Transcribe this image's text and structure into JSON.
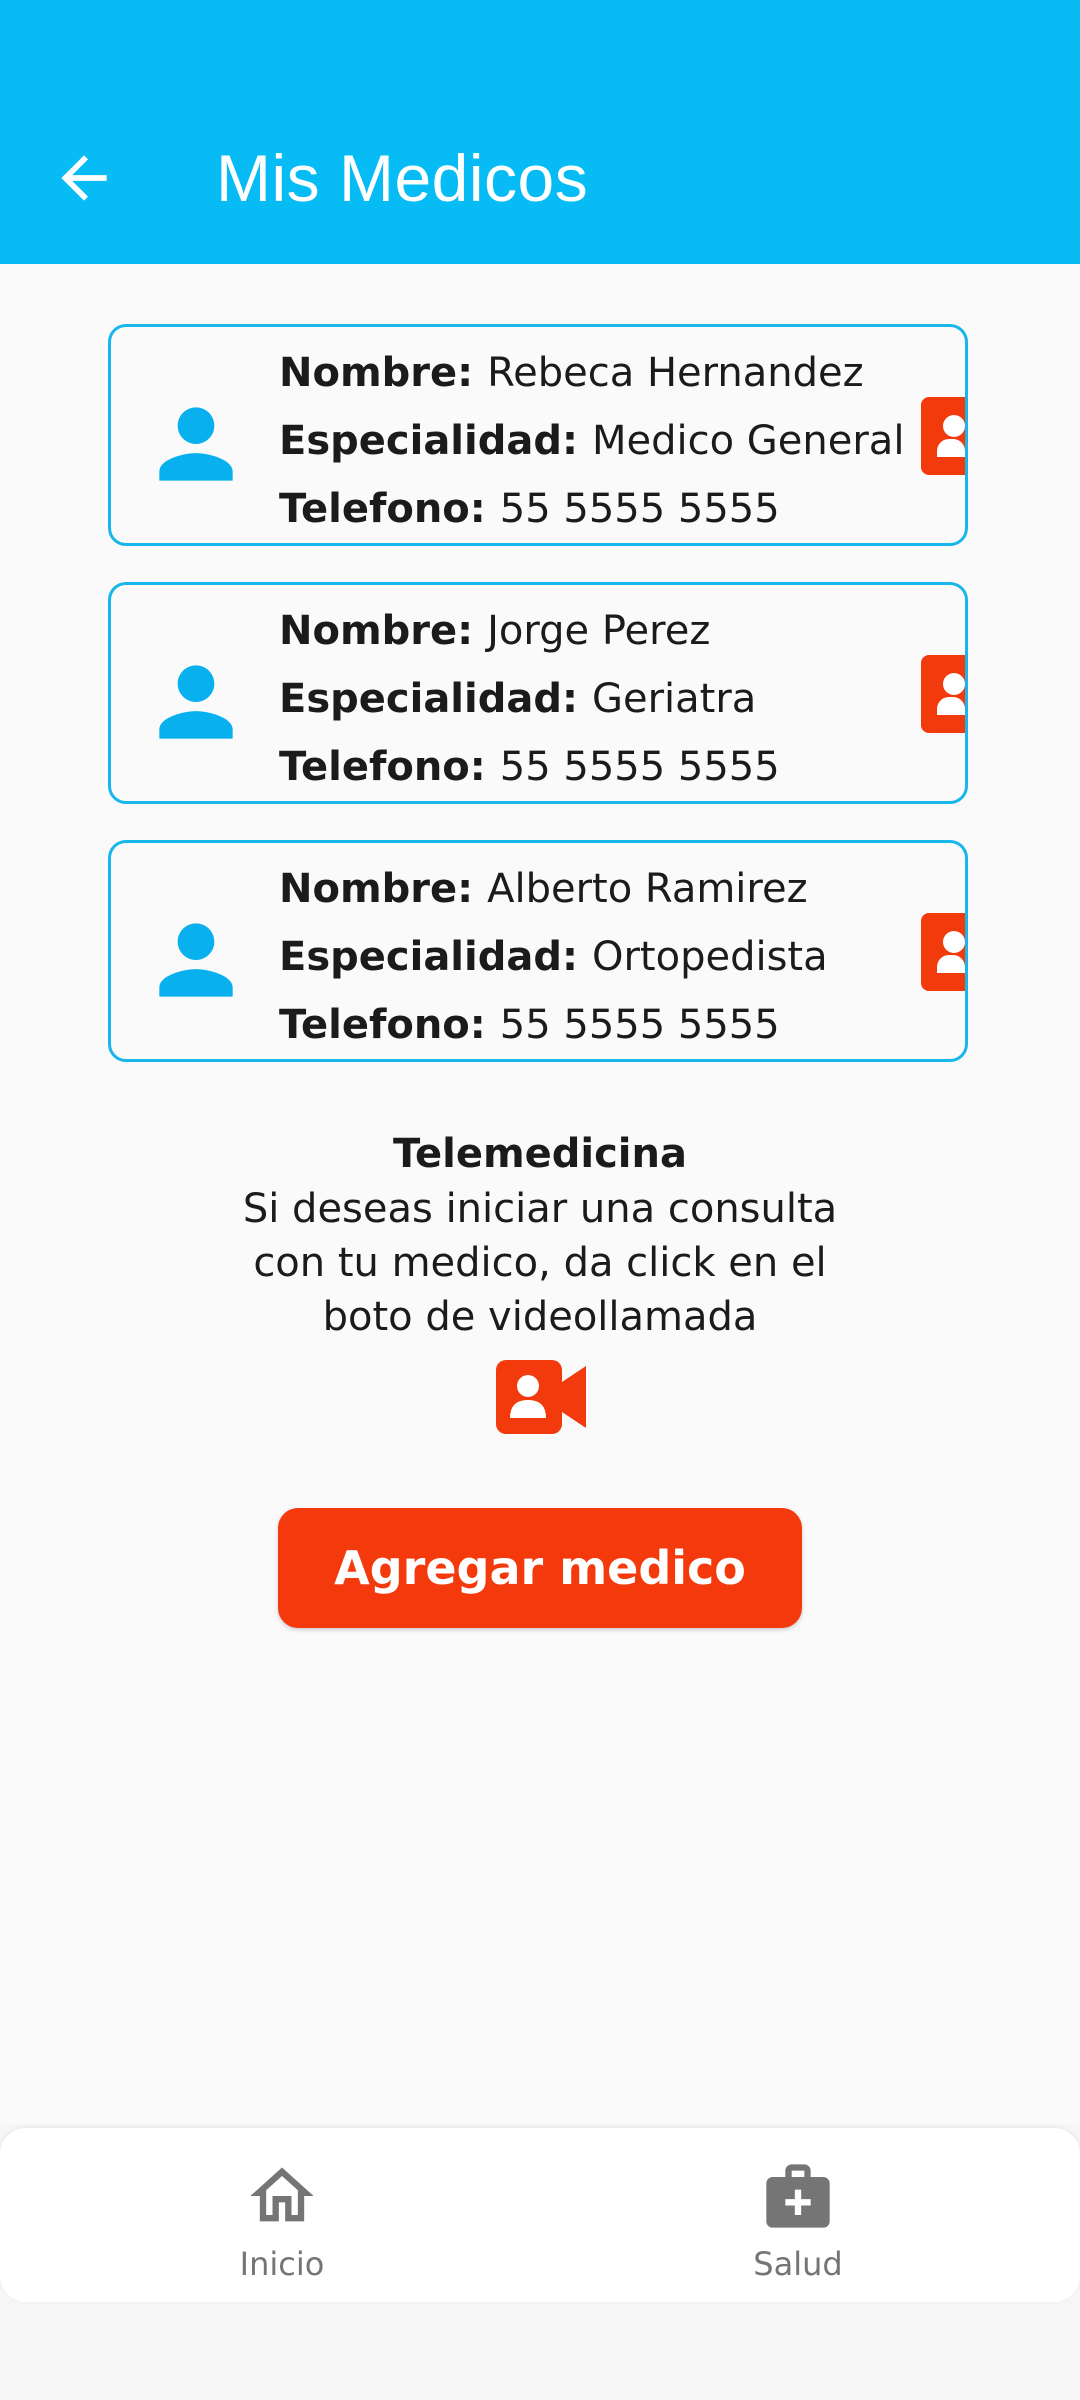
{
  "appbar": {
    "title": "Mis Medicos",
    "back_icon": "arrow-back-icon",
    "color": "#07bcf5"
  },
  "doctors": [
    {
      "nombre_label": "Nombre:",
      "nombre": "Rebeca Hernandez",
      "especialidad_label": "Especialidad:",
      "especialidad": "Medico General",
      "telefono_label": "Telefono:",
      "telefono": "55 5555 5555"
    },
    {
      "nombre_label": "Nombre:",
      "nombre": "Jorge Perez",
      "especialidad_label": "Especialidad:",
      "especialidad": "Geriatra",
      "telefono_label": "Telefono:",
      "telefono": "55 5555 5555"
    },
    {
      "nombre_label": "Nombre:",
      "nombre": "Alberto Ramirez",
      "especialidad_label": "Especialidad:",
      "especialidad": "Ortopedista",
      "telefono_label": "Telefono:",
      "telefono": "55 5555 5555"
    }
  ],
  "telemedicina": {
    "title": "Telemedicina",
    "description": "Si deseas iniciar una consulta con tu medico, da click en el boto de videollamada"
  },
  "add_button": {
    "label": "Agregar medico",
    "color": "#f43a0c"
  },
  "bottom_nav": [
    {
      "label": "Inicio",
      "icon": "home-icon"
    },
    {
      "label": "Salud",
      "icon": "medical-kit-icon"
    }
  ]
}
